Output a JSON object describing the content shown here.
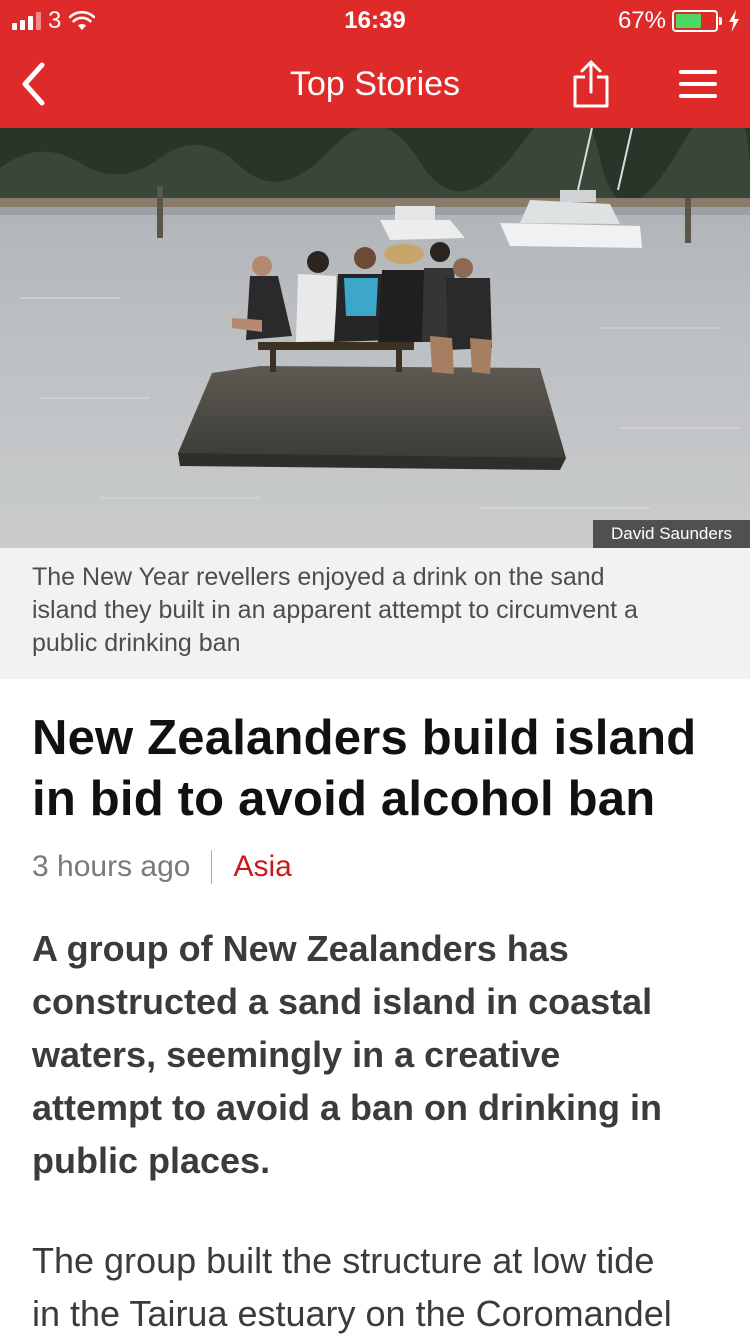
{
  "status_bar": {
    "carrier": "3",
    "time": "16:39",
    "battery_percent": "67%",
    "battery_level": 0.67,
    "charging": true,
    "signal_bars": 3
  },
  "nav": {
    "title": "Top Stories",
    "back_icon": "chevron-left-icon",
    "share_icon": "share-icon",
    "menu_icon": "hamburger-menu-icon"
  },
  "hero": {
    "photo_credit": "David Saunders"
  },
  "caption": {
    "lines": [
      "The New Year revellers enjoyed a drink on the sand",
      "island they built in an apparent attempt to circumvent a",
      "public drinking ban"
    ]
  },
  "article": {
    "headline_lines": [
      "New Zealanders build island",
      "in bid to avoid alcohol ban"
    ],
    "time_ago": "3 hours ago",
    "section": "Asia",
    "lead_lines": [
      "A group of New Zealanders has",
      "constructed a sand island in coastal",
      "waters, seemingly in a creative",
      "attempt to avoid a ban on drinking in",
      "public places."
    ],
    "body_lines": [
      "The group built the structure at low tide",
      "in the Tairua estuary on the Coromandel"
    ]
  },
  "colors": {
    "brand_red": "#df2a2a",
    "section_link": "#c8191c",
    "battery_green": "#4cd964"
  }
}
